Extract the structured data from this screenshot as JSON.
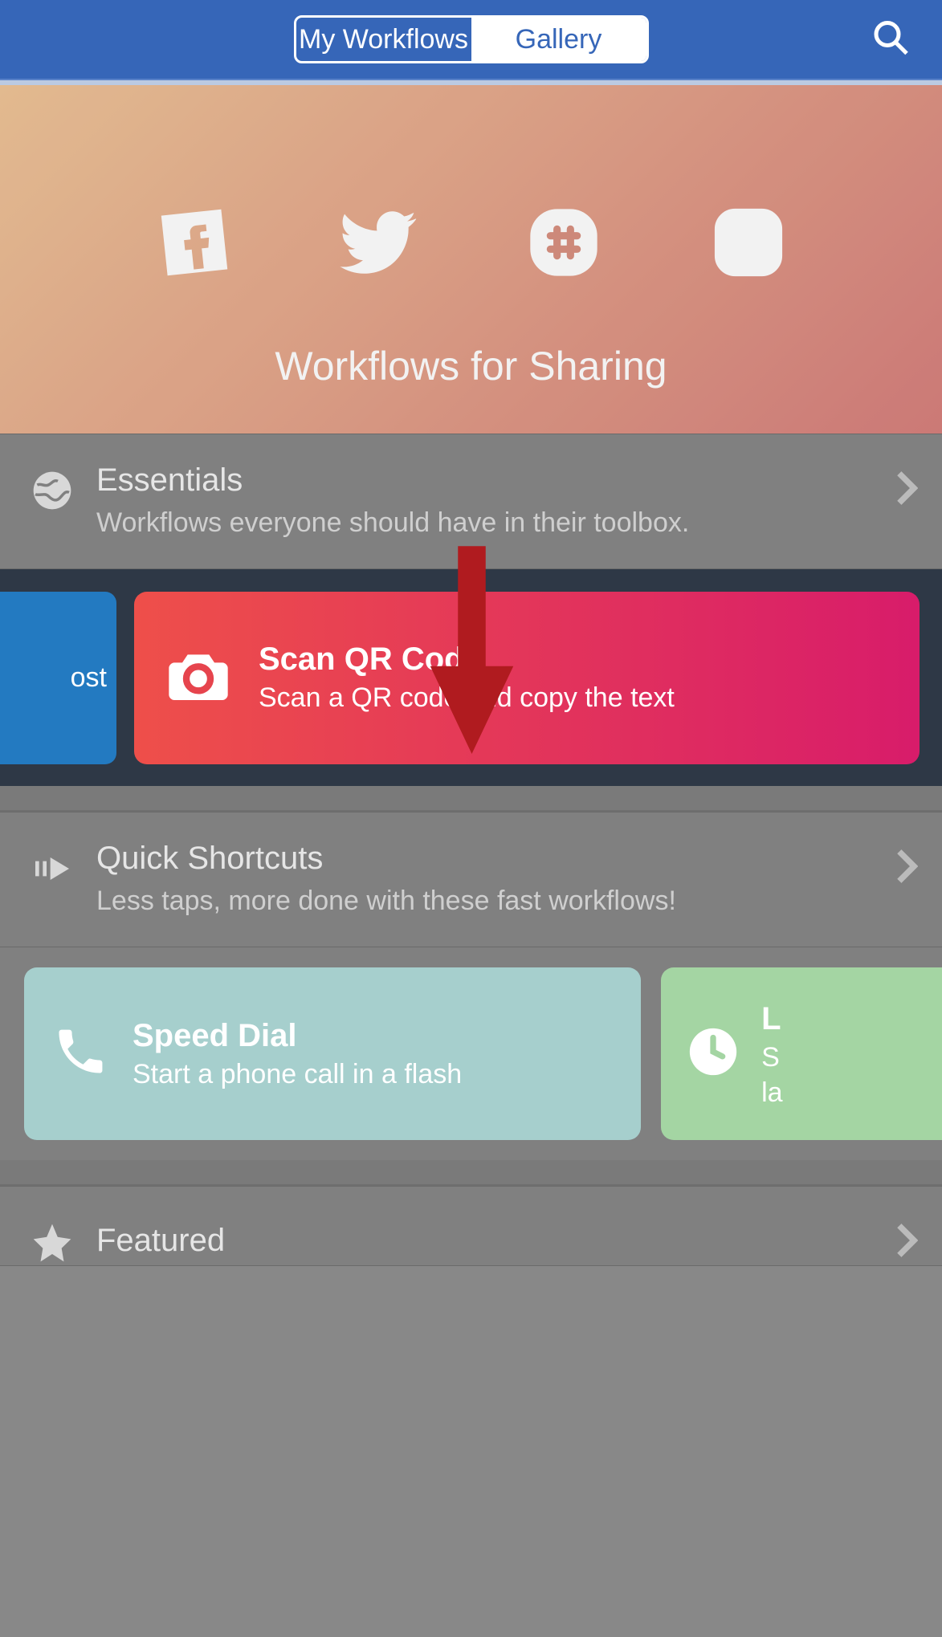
{
  "header": {
    "tabs": {
      "left": "My Workflows",
      "right": "Gallery"
    },
    "active_tab": "Gallery"
  },
  "hero": {
    "title": "Workflows for Sharing",
    "icons": [
      "facebook",
      "twitter",
      "slack",
      "instagram"
    ]
  },
  "sections": {
    "essentials": {
      "title": "Essentials",
      "subtitle": "Workflows everyone should have in their toolbox.",
      "cards": {
        "partial_left_label": "ost",
        "qr": {
          "title": "Scan QR Code",
          "subtitle": "Scan a QR code and copy the text"
        }
      }
    },
    "quick": {
      "title": "Quick Shortcuts",
      "subtitle": "Less taps, more done with these fast workflows!",
      "cards": {
        "speed": {
          "title": "Speed Dial",
          "subtitle": "Start a phone call in a flash"
        },
        "clock": {
          "title": "L",
          "sub1": "S",
          "sub2": "la"
        }
      }
    },
    "featured": {
      "title": "Featured"
    }
  }
}
